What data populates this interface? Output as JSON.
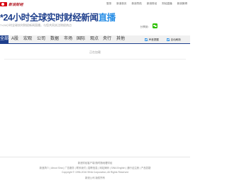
{
  "header": {
    "logo_text": "新浪财经",
    "top_links": [
      "登录",
      "新浪首页",
      "新浪导航",
      "新浪财经",
      "财经直播",
      "新浪微博"
    ]
  },
  "headline": {
    "main": "*24小时全球实时财经新闻",
    "live": "直播",
    "subtitle": "7×24小时全球实时财经新闻直播，与您共同关注财经热点",
    "share_label": "分享到："
  },
  "nav": {
    "tabs": [
      "全部",
      "A股",
      "宏观",
      "公司",
      "数据",
      "市场",
      "国际",
      "观点",
      "央行",
      "其他"
    ],
    "active_index": 0,
    "options": [
      "声音提醒",
      "自动刷新"
    ]
  },
  "content": {
    "loading_text": "正在加载"
  },
  "footer": {
    "lines": [
      "新浪财经客户端·随时随地看财经",
      "新浪简介 | About Sina | 广告服务 | 联系我们 | 招聘信息 | 网站律师 | SINA English | 通行证注册 | 产品答疑",
      "Copyright © 1996-2016 SINA Corporation, All Rights Reserved",
      "新浪公司 版权所有"
    ]
  },
  "colors": {
    "brand_red": "#d6000f",
    "headline_blue": "#1e3f8c",
    "live_blue": "#2a8fe6",
    "wechat_green": "#2dc100"
  }
}
